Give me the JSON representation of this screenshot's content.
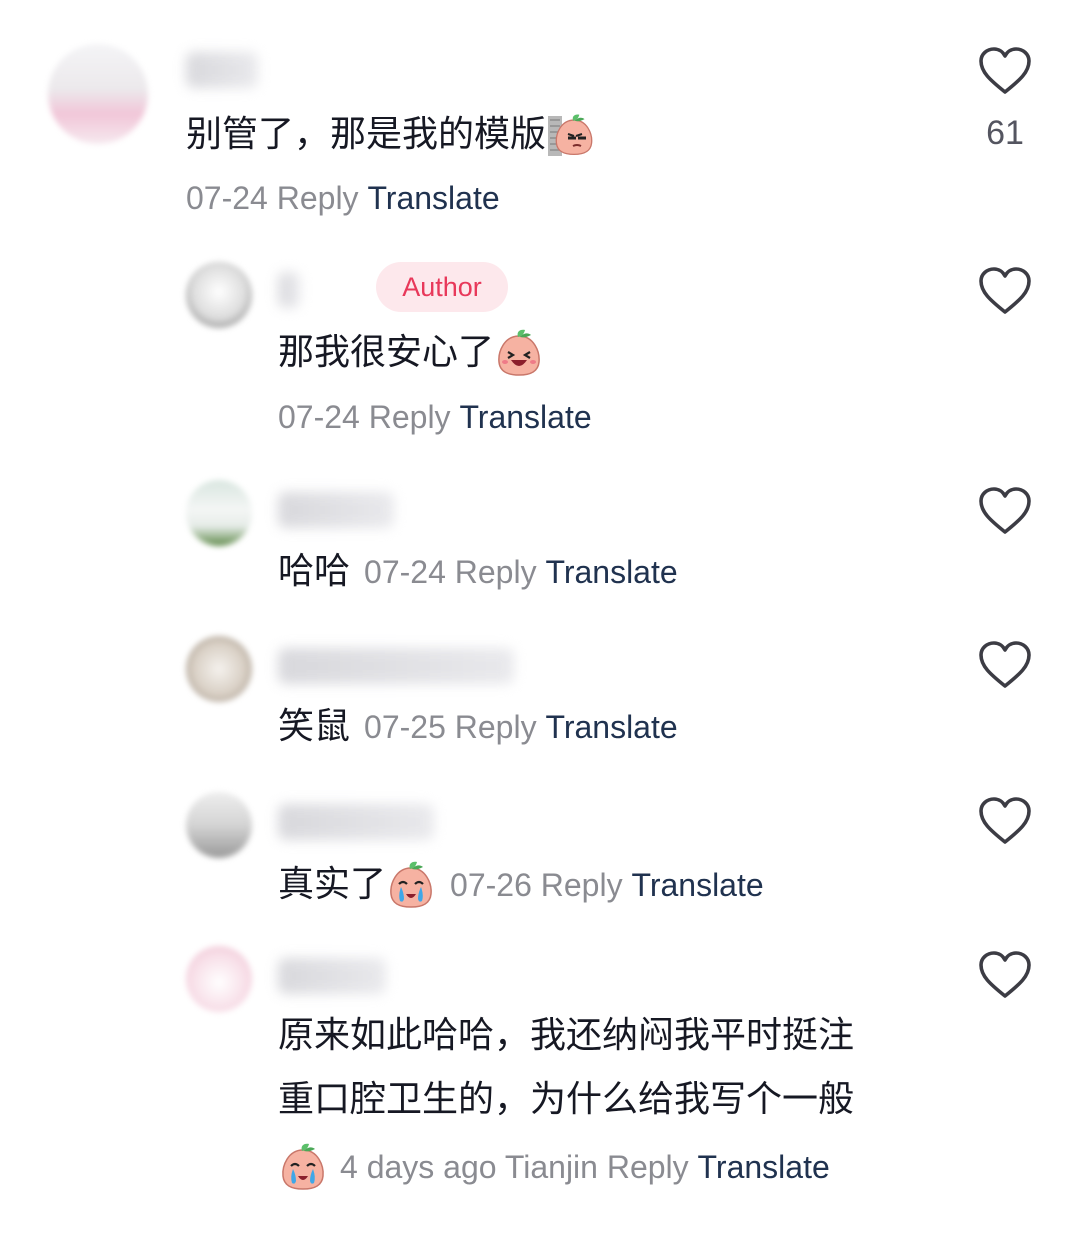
{
  "comments": [
    {
      "text": "别管了，那是我的模版",
      "date": "07-24",
      "reply": "Reply",
      "translate": "Translate",
      "likes": "61",
      "emoji": "smirk-peach-emoji"
    },
    {
      "badge": "Author",
      "text": "那我很安心了",
      "date": "07-24",
      "reply": "Reply",
      "translate": "Translate",
      "emoji": "laughing-peach-emoji"
    },
    {
      "text": "哈哈",
      "date": "07-24",
      "reply": "Reply",
      "translate": "Translate"
    },
    {
      "text": "笑鼠",
      "date": "07-25",
      "reply": "Reply",
      "translate": "Translate"
    },
    {
      "text": "真实了",
      "date": "07-26",
      "reply": "Reply",
      "translate": "Translate",
      "emoji": "crying-peach-emoji"
    },
    {
      "text_line1": "原来如此哈哈，我还纳闷我平时挺注",
      "text_line2": "重口腔卫生的，为什么给我写个一般",
      "date": "4 days ago",
      "location": "Tianjin",
      "reply": "Reply",
      "translate": "Translate",
      "emoji": "crying-peach-emoji"
    }
  ],
  "colors": {
    "text": "#161823",
    "meta": "#8a8b91",
    "translate": "#20324f",
    "author_badge_bg": "#fde8ec",
    "author_badge_text": "#e8385a",
    "like_icon": "#3c3c44"
  }
}
